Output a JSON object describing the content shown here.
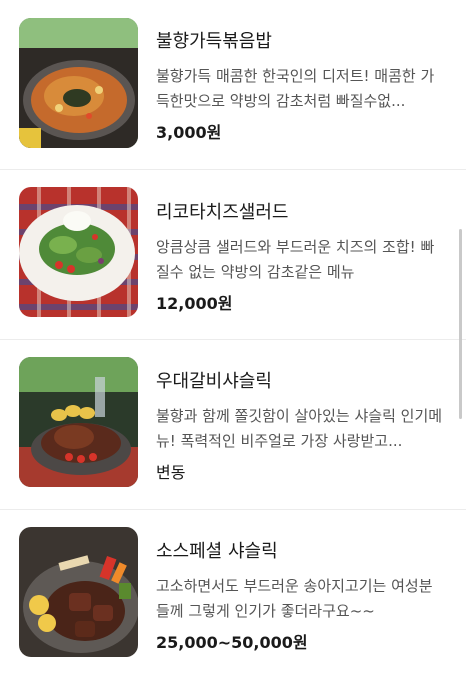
{
  "menu": {
    "items": [
      {
        "name": "불향가득볶음밥",
        "description": "불향가득 매콤한 한국인의 디저트! 매콤한 가득한맛으로 약방의 감초처럼 빠질수없...",
        "price": "3,000원",
        "image_icon": "fried-rice-photo"
      },
      {
        "name": "리코타치즈샐러드",
        "description": "앙큼상큼 샐러드와 부드러운 치즈의 조합! 빠질수 없는 약방의 감초같은 메뉴",
        "price": "12,000원",
        "image_icon": "ricotta-salad-photo"
      },
      {
        "name": "우대갈비샤슬릭",
        "description": "불향과 함께 쫄깃함이 살아있는 샤슬릭 인기메뉴! 폭력적인 비주얼로 가장 사랑받고...",
        "price": "변동",
        "image_icon": "rib-shashlik-photo"
      },
      {
        "name": "소스페셜 샤슬릭",
        "description": "고소하면서도 부드러운 송아지고기는 여성분들께 그렇게 인기가 좋더라구요~~",
        "price": "25,000~50,000원",
        "image_icon": "special-shashlik-photo"
      }
    ]
  }
}
